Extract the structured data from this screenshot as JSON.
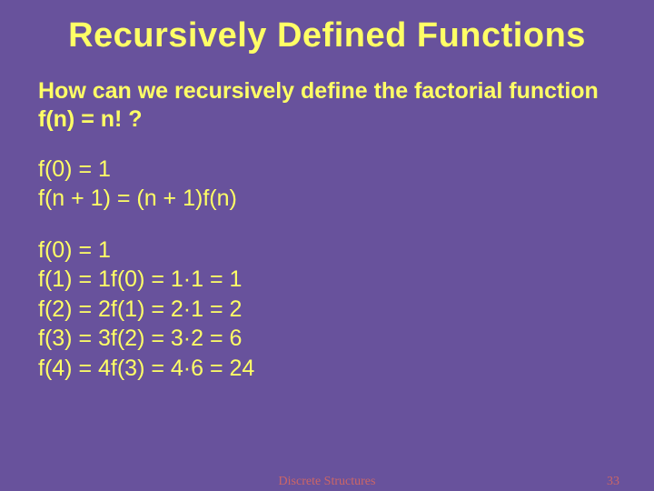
{
  "title": "Recursively Defined Functions",
  "subtitle": "How can we recursively define the factorial function f(n) = n! ?",
  "definition": {
    "base": "f(0) = 1",
    "step": "f(n + 1) = (n + 1)f(n)"
  },
  "expansion": {
    "l0": "f(0) = 1",
    "l1": "f(1) = 1f(0) = 1·1 = 1",
    "l2": "f(2) = 2f(1) = 2·1 = 2",
    "l3": "f(3) = 3f(2) = 3·2 = 6",
    "l4": "f(4) = 4f(3) = 4·6 = 24"
  },
  "footer": {
    "center": "Discrete Structures",
    "page": "33"
  }
}
